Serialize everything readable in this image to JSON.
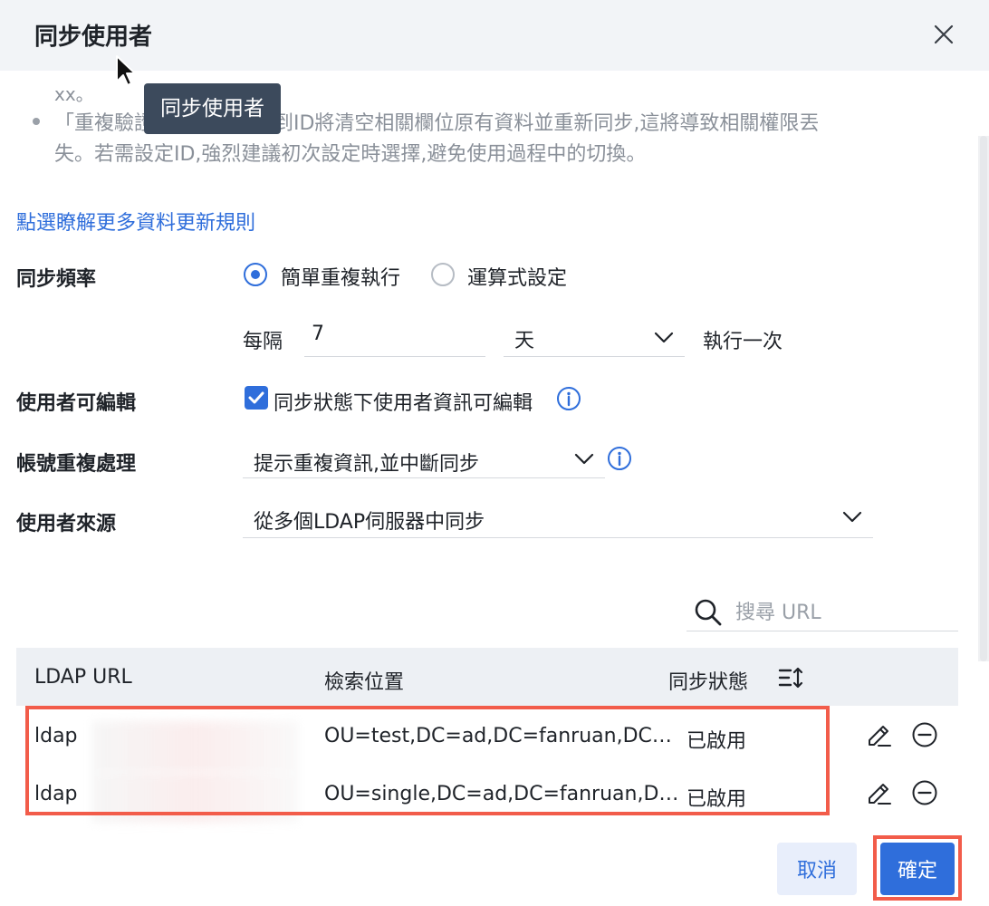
{
  "dialog": {
    "title": "同步使用者",
    "tooltip": "同步使用者"
  },
  "notes": {
    "fragment": "xx。",
    "line1": "「重複驗證」從帳號切換到ID將清空相關欄位原有資料並重新同步,這將導致相關權限丟",
    "line2": "失。若需設定ID,強烈建議初次設定時選擇,避免使用過程中的切換。"
  },
  "link": {
    "learn_more": "點選瞭解更多資料更新規則"
  },
  "sync_frequency": {
    "label": "同步頻率",
    "option_simple": "簡單重複執行",
    "option_expression": "運算式設定",
    "selected": "簡單重複執行",
    "prefix": "每隔",
    "interval_value": "7",
    "unit": "天",
    "suffix": "執行一次"
  },
  "user_editable": {
    "label": "使用者可編輯",
    "checkbox_label": "同步狀態下使用者資訊可編輯",
    "checked": true
  },
  "duplicate_handling": {
    "label": "帳號重複處理",
    "value": "提示重複資訊,並中斷同步"
  },
  "user_source": {
    "label": "使用者來源",
    "value": "從多個LDAP伺服器中同步"
  },
  "search": {
    "placeholder": "搜尋 URL"
  },
  "table": {
    "columns": {
      "url": "LDAP URL",
      "location": "檢索位置",
      "status": "同步狀態"
    },
    "rows": [
      {
        "url": "ldap",
        "location": "OU=test,DC=ad,DC=fanruan,DC…",
        "status": "已啟用"
      },
      {
        "url": "ldap",
        "location": "OU=single,DC=ad,DC=fanruan,D…",
        "status": "已啟用"
      }
    ]
  },
  "footer": {
    "cancel": "取消",
    "confirm": "確定"
  },
  "colors": {
    "accent": "#2f6edb",
    "highlight": "#f25c4a",
    "tooltip_bg": "#3c4a5c"
  },
  "icons": [
    "close-icon",
    "cursor-icon",
    "info-icon",
    "chevron-down-icon",
    "search-icon",
    "sort-icon",
    "edit-icon",
    "remove-icon",
    "check-icon"
  ]
}
